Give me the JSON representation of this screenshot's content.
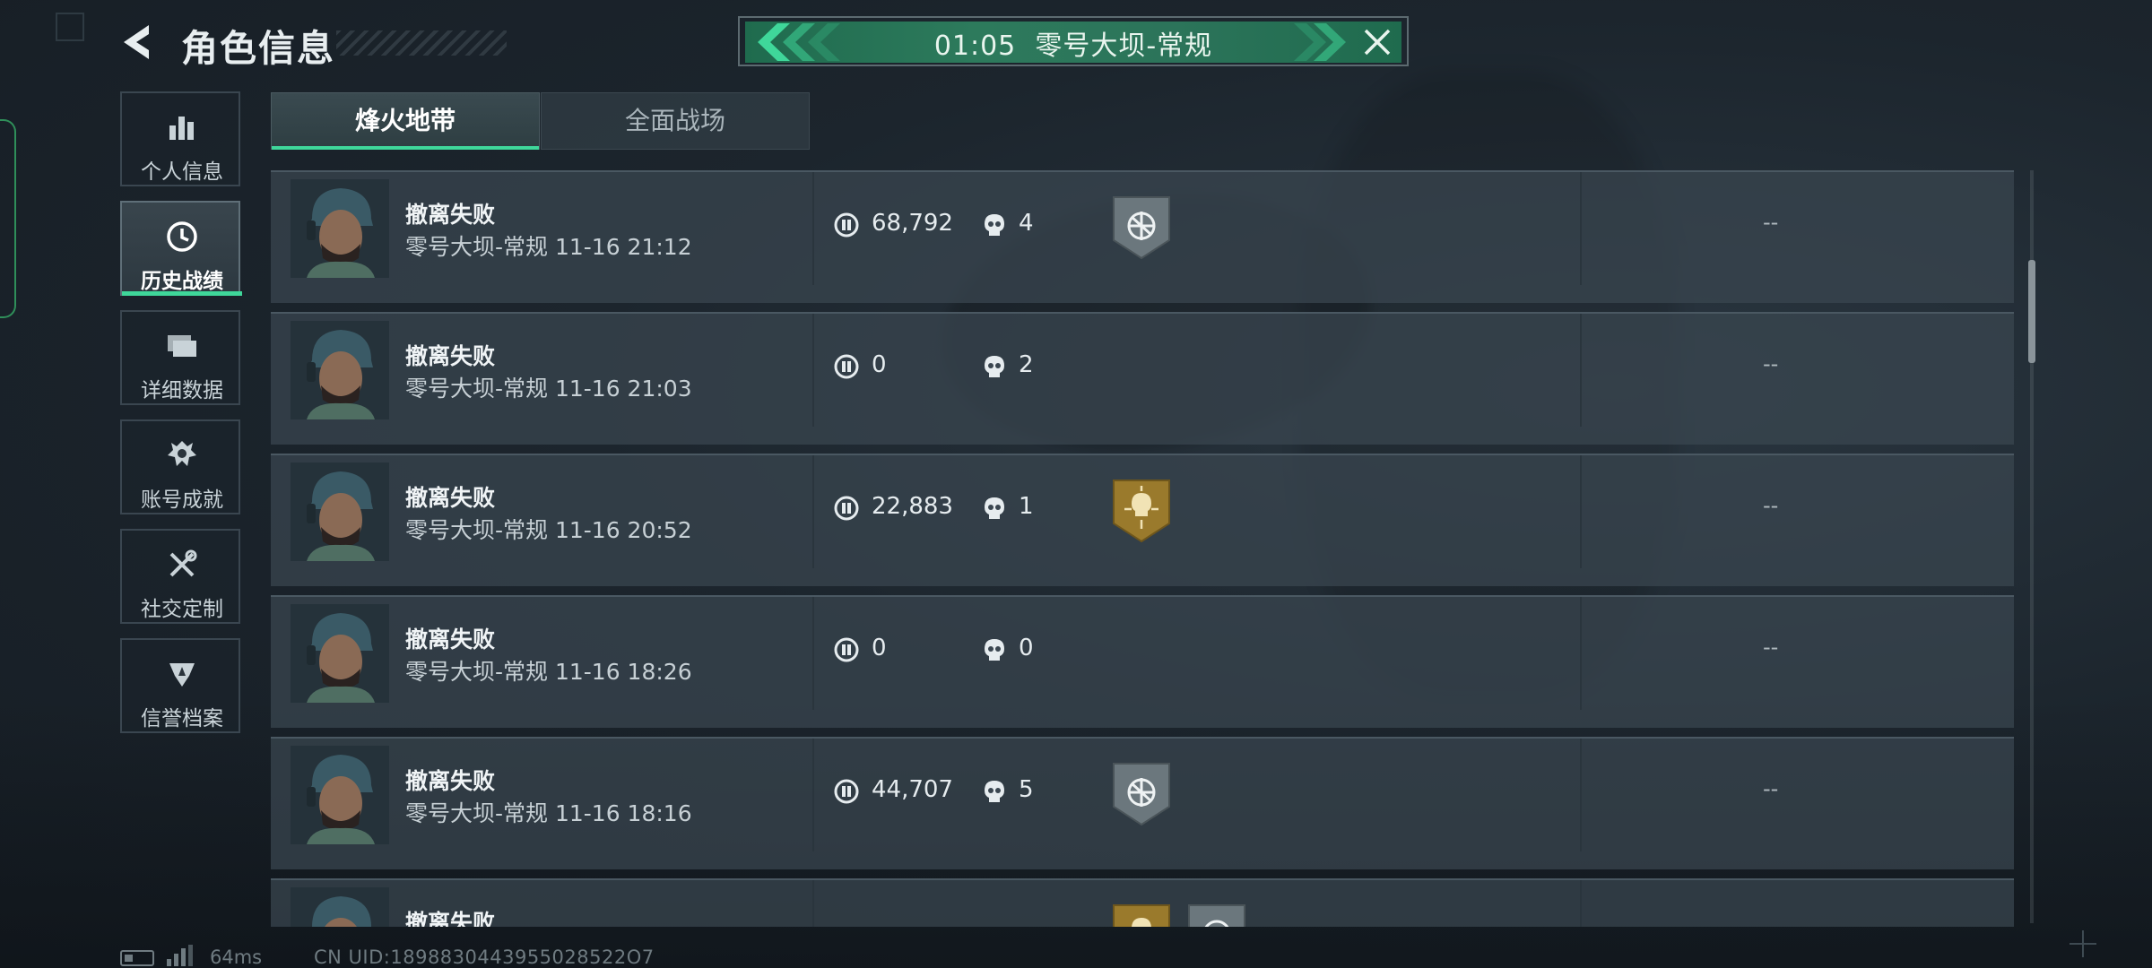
{
  "header": {
    "title": "角色信息",
    "match_banner": "01:05  零号大坝-常规"
  },
  "sidebar": {
    "items": [
      {
        "label": "个人信息",
        "icon": "bar-chart-icon",
        "active": false
      },
      {
        "label": "历史战绩",
        "icon": "clock-icon",
        "active": true
      },
      {
        "label": "详细数据",
        "icon": "folder-icon",
        "active": false
      },
      {
        "label": "账号成就",
        "icon": "achievement-icon",
        "active": false
      },
      {
        "label": "社交定制",
        "icon": "tools-icon",
        "active": false
      },
      {
        "label": "信誉档案",
        "icon": "shield-icon",
        "active": false
      }
    ]
  },
  "tabs": [
    {
      "label": "烽火地带",
      "active": true
    },
    {
      "label": "全面战场",
      "active": false
    }
  ],
  "matches": [
    {
      "status": "撤离失败",
      "detail": "零号大坝-常规 11-16 21:12",
      "coins": "68,792",
      "kills": "4",
      "badges": [
        "gray-crosshair-medal"
      ],
      "extra": "--"
    },
    {
      "status": "撤离失败",
      "detail": "零号大坝-常规 11-16 21:03",
      "coins": "0",
      "kills": "2",
      "badges": [],
      "extra": "--"
    },
    {
      "status": "撤离失败",
      "detail": "零号大坝-常规 11-16 20:52",
      "coins": "22,883",
      "kills": "1",
      "badges": [
        "gold-skull-medal"
      ],
      "extra": "--"
    },
    {
      "status": "撤离失败",
      "detail": "零号大坝-常规 11-16 18:26",
      "coins": "0",
      "kills": "0",
      "badges": [],
      "extra": "--"
    },
    {
      "status": "撤离失败",
      "detail": "零号大坝-常规 11-16 18:16",
      "coins": "44,707",
      "kills": "5",
      "badges": [
        "gray-crosshair-medal"
      ],
      "extra": "--"
    },
    {
      "status": "撤离失败",
      "detail": "",
      "coins": "",
      "kills": "",
      "badges": [
        "gold-skull-medal",
        "gray-crosshair-medal"
      ],
      "extra": ""
    }
  ],
  "footer": {
    "ping": "64ms",
    "uid": "CN UID:1898830443955028522O7"
  },
  "colors": {
    "accent": "#3fd79a",
    "banner": "#2d7a5c",
    "row_bg": "#3a4650",
    "gold_medal": "#9a7a2c",
    "gray_medal": "#6b777d"
  }
}
